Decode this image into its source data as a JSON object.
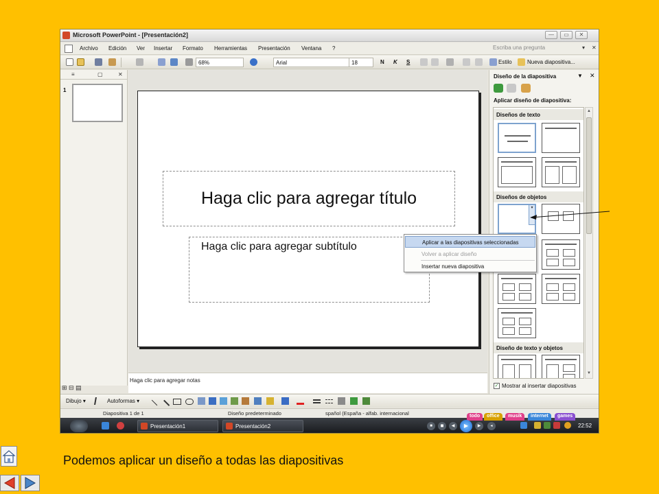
{
  "window": {
    "title": "Microsoft PowerPoint - [Presentación2]",
    "minimize_label": "—",
    "restore_label": "▭",
    "close_label": "✕"
  },
  "menu": {
    "items": [
      "Archivo",
      "Edición",
      "Ver",
      "Insertar",
      "Formato",
      "Herramientas",
      "Presentación",
      "Ventana",
      "?"
    ],
    "help_placeholder": "Escriba una pregunta",
    "help_arrow": "▾",
    "close_doc": "✕"
  },
  "toolbar": {
    "zoom": "68%",
    "font": "Arial",
    "size": "18",
    "bold": "N",
    "italic": "K",
    "underline": "S",
    "style_label": "Estilo",
    "new_slide_label": "Nueva diapositiva..."
  },
  "slides_pane": {
    "tab_outline": "≡",
    "tab_slides": "▢",
    "close": "✕",
    "slide_number": "1"
  },
  "slide": {
    "title_placeholder": "Haga clic para agregar título",
    "subtitle_placeholder": "Haga clic para agregar subtítulo"
  },
  "notes": {
    "placeholder": "Haga clic para agregar notas"
  },
  "view_buttons": "⊞ ⊟ ▤",
  "task_pane": {
    "title": "Diseño de la diapositiva",
    "menu_arrow": "▼",
    "close": "✕",
    "apply_label": "Aplicar diseño de diapositiva:",
    "sections": [
      "Diseños de texto",
      "Diseños de objetos",
      "Diseño de texto y objetos"
    ],
    "show_checkbox": "Mostrar al insertar diapositivas",
    "checkbox_checked": "✓",
    "dropdown_glyph": "▾"
  },
  "context_menu": {
    "items": [
      {
        "label": "Aplicar a las diapositivas seleccionadas",
        "state": "highlighted"
      },
      {
        "label": "Volver a aplicar diseño",
        "state": "disabled"
      },
      {
        "label": "Insertar nueva diapositiva",
        "state": "normal"
      }
    ]
  },
  "drawing_toolbar": {
    "draw_label": "Dibujo ▾",
    "autoshapes_label": "Autoformas ▾"
  },
  "status_bar": {
    "slide_info": "Diapositiva 1 de 1",
    "design": "Diseño predeterminado",
    "language": "spañol (España - alfab. internacional"
  },
  "taskbar": {
    "task1": "Presentación1",
    "task2": "Presentación2",
    "clock": "22:52",
    "deskbar_tabs": [
      {
        "label": "todo",
        "color": "#e0408a"
      },
      {
        "label": "office",
        "color": "#d7a000"
      },
      {
        "label": "musik",
        "color": "#e0408a"
      },
      {
        "label": "internet",
        "color": "#3a86d9"
      },
      {
        "label": "games",
        "color": "#8a4fd0"
      }
    ]
  },
  "caption": "Podemos aplicar un diseño a todas las diapositivas",
  "colors": {
    "background": "#FFC000",
    "selection": "#C6D8F0",
    "powerpoint_orange": "#D24726"
  }
}
